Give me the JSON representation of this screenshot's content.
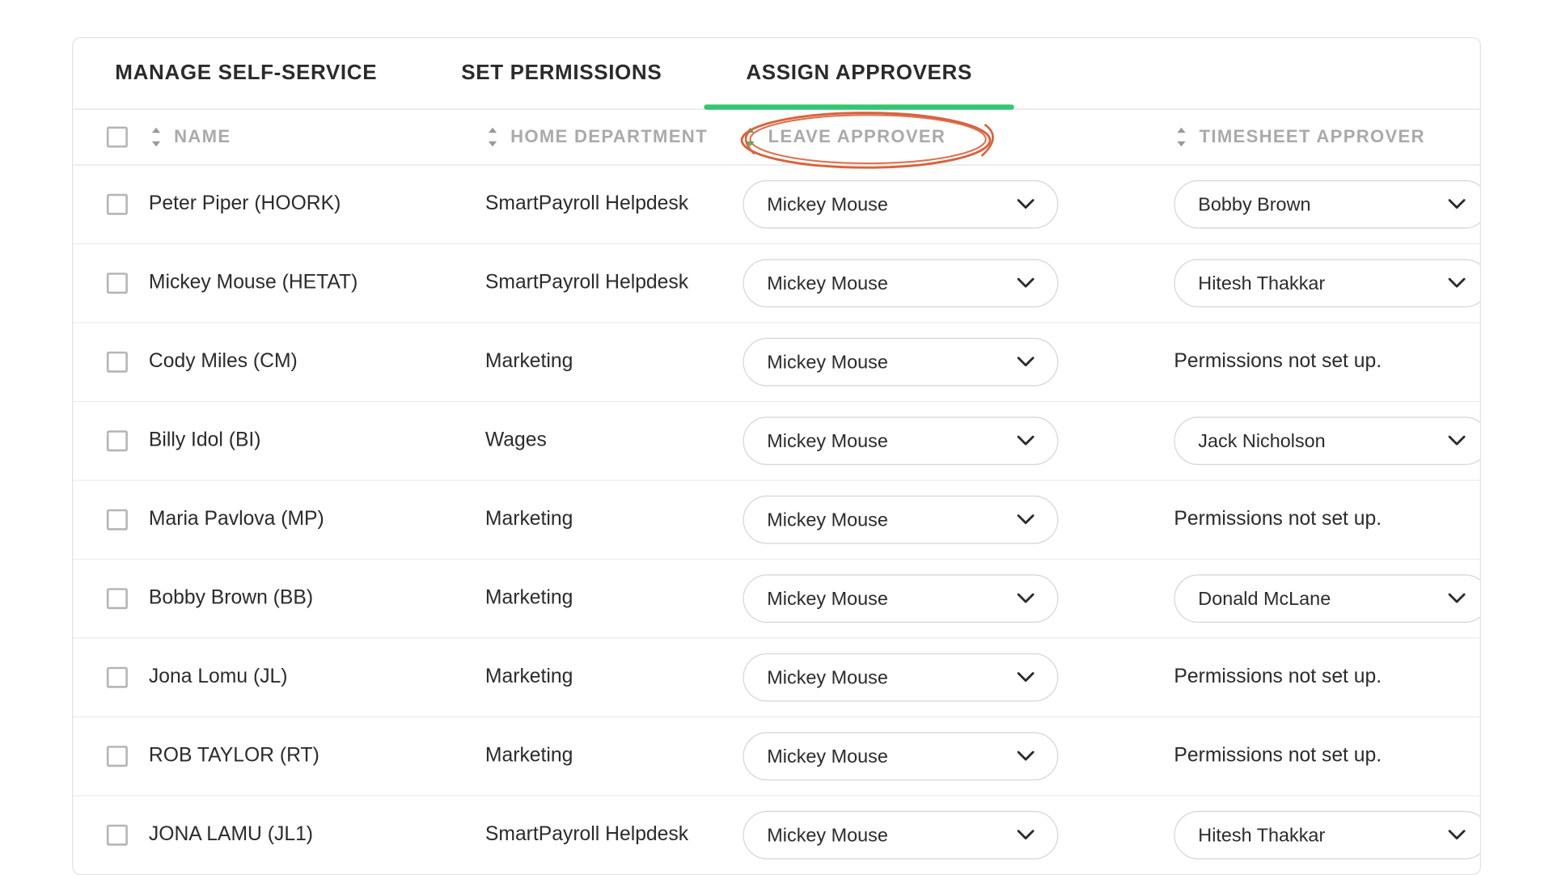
{
  "tabs": [
    {
      "label": "MANAGE SELF-SERVICE",
      "active": false
    },
    {
      "label": "SET PERMISSIONS",
      "active": false
    },
    {
      "label": "ASSIGN APPROVERS",
      "active": true
    }
  ],
  "columns": {
    "name": "NAME",
    "dept": "HOME DEPARTMENT",
    "leave": "LEAVE APPROVER",
    "tsheet": "TIMESHEET APPROVER"
  },
  "not_setup_text": "Permissions not set up.",
  "annotation": {
    "color": "#d9623b"
  },
  "colors": {
    "accent": "#33c770"
  },
  "rows": [
    {
      "name": "Peter Piper (HOORK)",
      "dept": "SmartPayroll Helpdesk",
      "leave": "Mickey Mouse",
      "tsheet": "Bobby Brown"
    },
    {
      "name": "Mickey Mouse (HETAT)",
      "dept": "SmartPayroll Helpdesk",
      "leave": "Mickey Mouse",
      "tsheet": "Hitesh Thakkar"
    },
    {
      "name": "Cody Miles (CM)",
      "dept": "Marketing",
      "leave": "Mickey Mouse",
      "tsheet": null
    },
    {
      "name": "Billy Idol (BI)",
      "dept": "Wages",
      "leave": "Mickey Mouse",
      "tsheet": "Jack Nicholson"
    },
    {
      "name": "Maria Pavlova (MP)",
      "dept": "Marketing",
      "leave": "Mickey Mouse",
      "tsheet": null
    },
    {
      "name": "Bobby Brown (BB)",
      "dept": "Marketing",
      "leave": "Mickey Mouse",
      "tsheet": "Donald McLane"
    },
    {
      "name": "Jona Lomu (JL)",
      "dept": "Marketing",
      "leave": "Mickey Mouse",
      "tsheet": null
    },
    {
      "name": "ROB TAYLOR (RT)",
      "dept": "Marketing",
      "leave": "Mickey Mouse",
      "tsheet": null
    },
    {
      "name": "JONA LAMU (JL1)",
      "dept": "SmartPayroll Helpdesk",
      "leave": "Mickey Mouse",
      "tsheet": "Hitesh Thakkar"
    }
  ]
}
